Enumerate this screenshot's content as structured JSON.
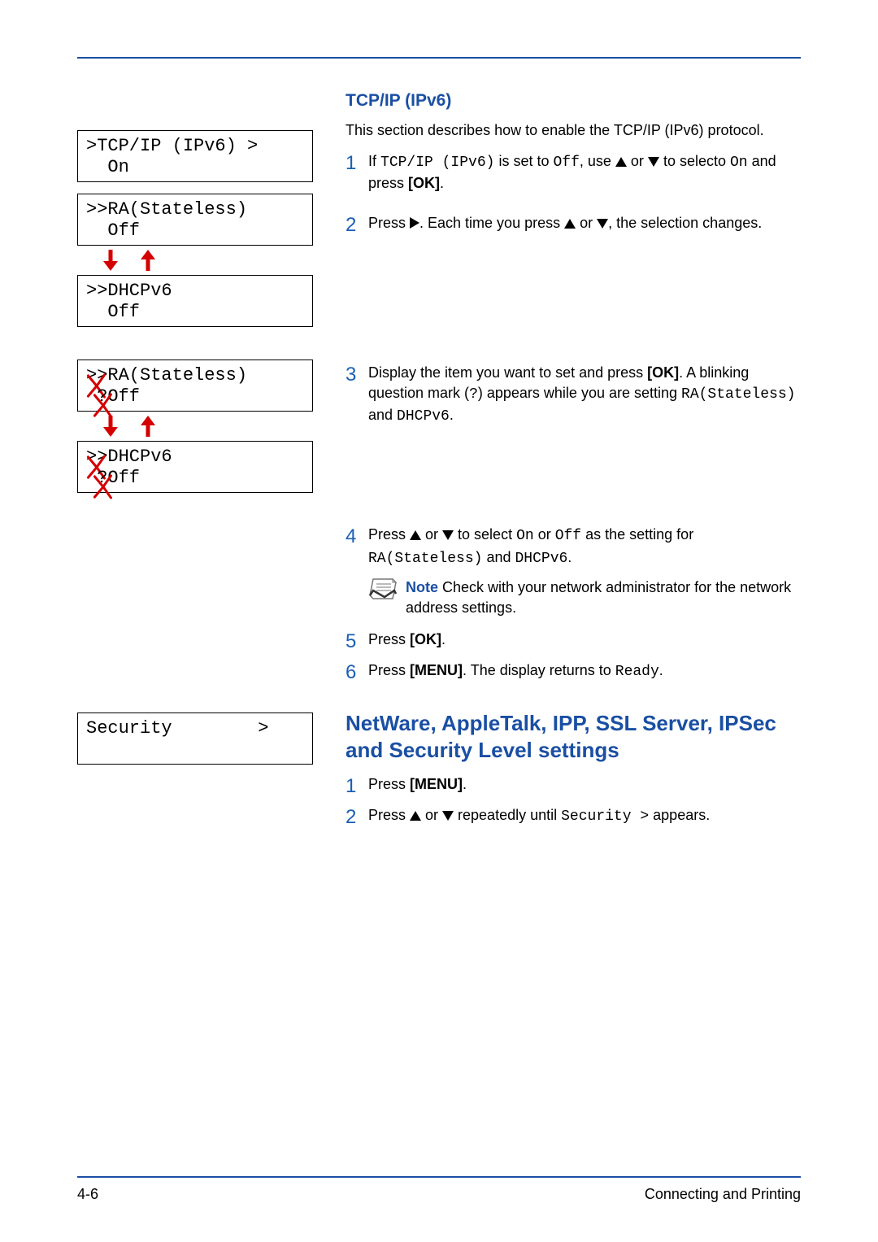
{
  "heading_tcpip": "TCP/IP (IPv6)",
  "intro_tcpip": "This section describes how to enable the TCP/IP (IPv6) protocol.",
  "lcd": {
    "tcpip_l1": ">TCP/IP (IPv6) >",
    "tcpip_l2": "  On",
    "ra_l1": ">>RA(Stateless)",
    "ra_l2": "  Off",
    "dhcpv6_l1": ">>DHCPv6",
    "dhcpv6_l2": "  Off",
    "ra_q_prefix": ">>",
    "ra_q_rest": "RA(Stateless)",
    "ra_q2_q": "?",
    "ra_q2_rest": "Off",
    "dh_q_prefix": ">>",
    "dh_q_rest": "DHCPv6",
    "dh_q2_q": "?",
    "dh_q2_rest": "Off",
    "security_l1": "Security        >"
  },
  "steps_a": {
    "s1_a": "If ",
    "s1_code1": "TCP/IP (IPv6)",
    "s1_b": " is set to ",
    "s1_code2": "Off",
    "s1_c": ", use ",
    "s1_d": " or ",
    "s1_e": " to selecto ",
    "s1_code3": "On",
    "s1_f": " and press  ",
    "s1_ok": "[OK]",
    "s1_g": ".",
    "s2_a": "Press ",
    "s2_b": ". Each time you press ",
    "s2_c": " or ",
    "s2_d": ", the selection changes.",
    "s3_a": "Display the item you want to set and press ",
    "s3_ok": "[OK]",
    "s3_b": ". A blinking question mark (",
    "s3_q": "?",
    "s3_c": ") appears while you are setting ",
    "s3_code1": "RA(Stateless)",
    "s3_d": " and ",
    "s3_code2": "DHCPv6",
    "s3_e": ".",
    "s4_a": "Press ",
    "s4_b": " or ",
    "s4_c": " to select ",
    "s4_code1": "On",
    "s4_d": " or ",
    "s4_code2": "Off",
    "s4_e": " as the setting for ",
    "s4_code3": "RA(Stateless)",
    "s4_f": " and ",
    "s4_code4": "DHCPv6",
    "s4_g": ".",
    "note_label": "Note",
    "note_text": "  Check with your network administrator for the network address settings.",
    "s5_a": "Press ",
    "s5_ok": "[OK]",
    "s5_b": ".",
    "s6_a": "Press ",
    "s6_menu": "[MENU]",
    "s6_b": ". The display returns to ",
    "s6_code": "Ready",
    "s6_c": "."
  },
  "heading_netware": "NetWare, AppleTalk, IPP, SSL Server, IPSec and Security Level settings",
  "steps_b": {
    "s1_a": "Press ",
    "s1_menu": "[MENU]",
    "s1_b": ".",
    "s2_a": "Press ",
    "s2_b": " or ",
    "s2_c": " repeatedly until ",
    "s2_code": "Security >",
    "s2_d": " appears."
  },
  "footer": {
    "page": "4-6",
    "title": "Connecting and Printing"
  }
}
